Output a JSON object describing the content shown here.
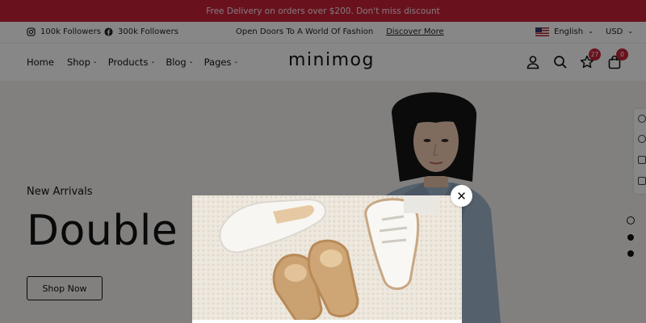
{
  "announcement": "Free Delivery on orders over $200. Don't miss discount",
  "topbar": {
    "instagram_followers": "100k Followers",
    "facebook_followers": "300k Followers",
    "tagline": "Open Doors To A World Of Fashion",
    "discover_link": "Discover More",
    "language": "English",
    "currency": "USD"
  },
  "nav": {
    "items": [
      {
        "label": "Home",
        "has_dropdown": false
      },
      {
        "label": "Shop",
        "has_dropdown": true
      },
      {
        "label": "Products",
        "has_dropdown": true
      },
      {
        "label": "Blog",
        "has_dropdown": true
      },
      {
        "label": "Pages",
        "has_dropdown": true
      }
    ]
  },
  "brand": {
    "logo": "minimog"
  },
  "header_icons": {
    "wishlist_count": "27",
    "cart_count": "0"
  },
  "hero": {
    "subtitle": "New Arrivals",
    "title": "Double B",
    "button": "Shop Now"
  },
  "popup": {
    "close_symbol": "✕"
  },
  "colors": {
    "accent": "#c7233a",
    "overlay": "rgba(0,0,0,0.47)"
  },
  "icons": [
    "instagram-icon",
    "facebook-icon",
    "user-icon",
    "search-icon",
    "star-icon",
    "bag-icon",
    "close-icon"
  ]
}
